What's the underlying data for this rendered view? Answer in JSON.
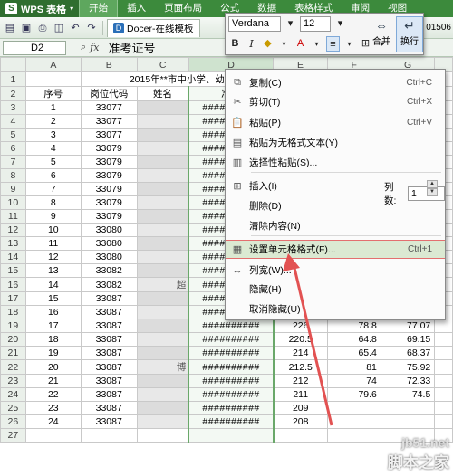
{
  "app": {
    "title": "WPS 表格"
  },
  "menu": {
    "tabs": [
      "开始",
      "插入",
      "页面布局",
      "公式",
      "数据",
      "表格样式",
      "审阅",
      "视图"
    ],
    "active_index": 0
  },
  "toolbar": {
    "docer_tab": "Docer-在线模板",
    "cut_text": "01506"
  },
  "formula_bar": {
    "cell_ref": "D2",
    "value": "准考证号"
  },
  "sheet": {
    "columns": [
      "A",
      "B",
      "C",
      "D",
      "E",
      "F",
      "G"
    ],
    "title": "2015年**市中小学、幼",
    "headers": [
      "序号",
      "岗位代码",
      "姓名",
      "准考"
    ],
    "rows": [
      {
        "no": "1",
        "code": "33077",
        "d": "##########",
        "e": "",
        "f": "",
        "g": "",
        "c_note": ""
      },
      {
        "no": "2",
        "code": "33077",
        "d": "##########",
        "e": "",
        "f": "",
        "g": "",
        "c_note": ""
      },
      {
        "no": "3",
        "code": "33077",
        "d": "##########",
        "e": "",
        "f": "",
        "g": "",
        "c_note": ""
      },
      {
        "no": "4",
        "code": "33079",
        "d": "##########",
        "e": "",
        "f": "",
        "g": "",
        "c_note": ""
      },
      {
        "no": "5",
        "code": "33079",
        "d": "##########",
        "e": "",
        "f": "",
        "g": "",
        "c_note": ""
      },
      {
        "no": "6",
        "code": "33079",
        "d": "##########",
        "e": "",
        "f": "",
        "g": "",
        "c_note": ""
      },
      {
        "no": "7",
        "code": "33079",
        "d": "##########",
        "e": "",
        "f": "",
        "g": "",
        "c_note": ""
      },
      {
        "no": "8",
        "code": "33079",
        "d": "##########",
        "e": "",
        "f": "",
        "g": "",
        "c_note": ""
      },
      {
        "no": "9",
        "code": "33079",
        "d": "##########",
        "e": "",
        "f": "",
        "g": "",
        "c_note": ""
      },
      {
        "no": "10",
        "code": "33080",
        "d": "##########",
        "e": "",
        "f": "",
        "g": "",
        "c_note": ""
      },
      {
        "no": "11",
        "code": "33080",
        "d": "##########",
        "e": "",
        "f": "",
        "g": "",
        "c_note": ""
      },
      {
        "no": "12",
        "code": "33080",
        "d": "##########",
        "e": "",
        "f": "",
        "g": "",
        "c_note": ""
      },
      {
        "no": "13",
        "code": "33082",
        "d": "##########",
        "e": "",
        "f": "",
        "g": "",
        "c_note": ""
      },
      {
        "no": "14",
        "code": "33082",
        "d": "##########",
        "e": "",
        "f": "",
        "g": "",
        "c_note": "超"
      },
      {
        "no": "15",
        "code": "33087",
        "d": "##########",
        "e": "",
        "f": "",
        "g": "",
        "c_note": ""
      },
      {
        "no": "16",
        "code": "33087",
        "d": "##########",
        "e": "228",
        "f": "73",
        "g": "74.5",
        "c_note": ""
      },
      {
        "no": "17",
        "code": "33087",
        "d": "##########",
        "e": "226",
        "f": "78.8",
        "g": "77.07",
        "c_note": ""
      },
      {
        "no": "18",
        "code": "33087",
        "d": "##########",
        "e": "220.5",
        "f": "64.8",
        "g": "69.15",
        "c_note": ""
      },
      {
        "no": "19",
        "code": "33087",
        "d": "##########",
        "e": "214",
        "f": "65.4",
        "g": "68.37",
        "c_note": ""
      },
      {
        "no": "20",
        "code": "33087",
        "d": "##########",
        "e": "212.5",
        "f": "81",
        "g": "75.92",
        "c_note": "博"
      },
      {
        "no": "21",
        "code": "33087",
        "d": "##########",
        "e": "212",
        "f": "74",
        "g": "72.33",
        "c_note": ""
      },
      {
        "no": "22",
        "code": "33087",
        "d": "##########",
        "e": "211",
        "f": "79.6",
        "g": "74.5",
        "c_note": ""
      },
      {
        "no": "23",
        "code": "33087",
        "d": "##########",
        "e": "209",
        "f": "",
        "g": "",
        "c_note": ""
      },
      {
        "no": "24",
        "code": "33087",
        "d": "##########",
        "e": "208",
        "f": "",
        "g": "",
        "c_note": ""
      }
    ],
    "row_numbers": [
      "1",
      "2",
      "3",
      "4",
      "5",
      "6",
      "7",
      "8",
      "9",
      "10",
      "11",
      "12",
      "13",
      "14",
      "15",
      "16",
      "17",
      "18",
      "19",
      "20",
      "21",
      "22",
      "23",
      "24",
      "25",
      "26",
      "27"
    ]
  },
  "mini_toolbar": {
    "font": "Verdana",
    "size": "12",
    "merge_label": "合并",
    "wrap_label": "换行"
  },
  "context_menu": {
    "items": [
      {
        "label": "复制(C)",
        "shortcut": "Ctrl+C",
        "icon": "copy-icon"
      },
      {
        "label": "剪切(T)",
        "shortcut": "Ctrl+X",
        "icon": "scissors-icon"
      },
      {
        "label": "粘贴(P)",
        "shortcut": "Ctrl+V",
        "icon": "paste-icon"
      },
      {
        "label": "粘贴为无格式文本(Y)",
        "shortcut": "",
        "icon": "paste-text-icon"
      },
      {
        "label": "选择性粘贴(S)...",
        "shortcut": "",
        "icon": "paste-special-icon"
      },
      {
        "label": "插入(I)",
        "shortcut": "",
        "icon": "insert-icon"
      },
      {
        "label": "删除(D)",
        "shortcut": "",
        "icon": ""
      },
      {
        "label": "清除内容(N)",
        "shortcut": "",
        "icon": ""
      },
      {
        "label": "设置单元格格式(F)...",
        "shortcut": "Ctrl+1",
        "icon": "format-cells-icon"
      },
      {
        "label": "列宽(W)...",
        "shortcut": "",
        "icon": "column-width-icon"
      },
      {
        "label": "隐藏(H)",
        "shortcut": "",
        "icon": ""
      },
      {
        "label": "取消隐藏(U)",
        "shortcut": "",
        "icon": ""
      }
    ],
    "columns_label": "列数:",
    "columns_value": "1",
    "highlight_index": 8
  },
  "watermark": {
    "url": "jb51.net",
    "text": "脚本之家"
  },
  "colors": {
    "menubar": "#3c8a3c",
    "highlight": "#dbe9d2",
    "annotation_red": "#e25252"
  }
}
